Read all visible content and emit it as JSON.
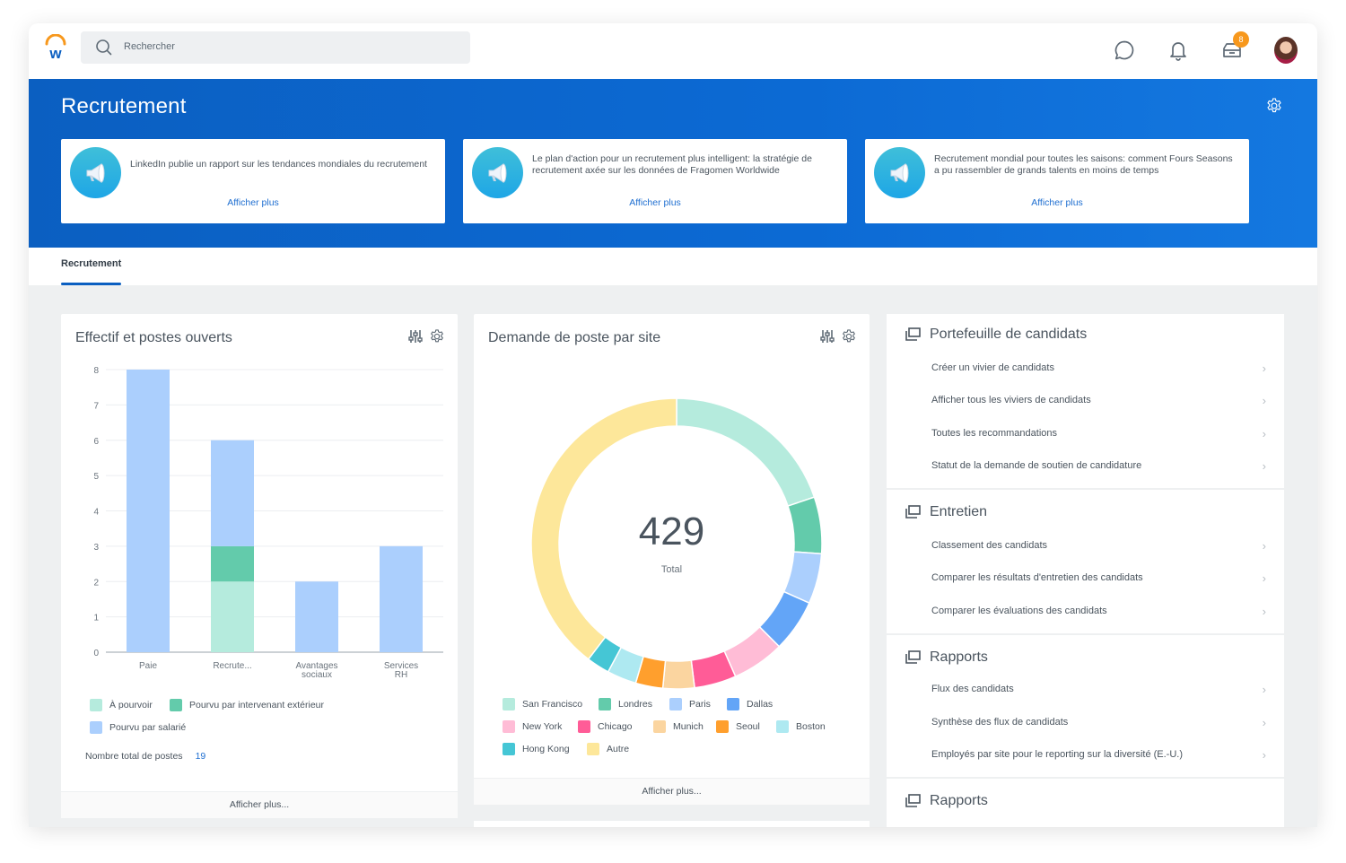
{
  "app": {
    "logo": "workday-logo"
  },
  "search": {
    "placeholder": "Rechercher"
  },
  "header_icons": {
    "chat": "chat-icon",
    "bell": "bell-icon",
    "inbox": "inbox-icon",
    "inbox_badge": "8",
    "avatar": "avatar"
  },
  "banner": {
    "title": "Recrutement",
    "news": [
      {
        "text": "LinkedIn publie un rapport sur les tendances mondiales du recrutement",
        "link": "Afficher plus"
      },
      {
        "text": "Le plan d'action pour un recrutement plus intelligent: la stratégie de recrutement axée sur les données de Fragomen Worldwide",
        "link": "Afficher plus"
      },
      {
        "text": "Recrutement mondial pour toutes les saisons: comment Fours Seasons a pu rassembler de grands talents en moins de temps",
        "link": "Afficher plus"
      }
    ]
  },
  "tabs": [
    {
      "label": "Recrutement",
      "active": true
    }
  ],
  "cards": {
    "headcount": {
      "title": "Effectif et postes ouverts",
      "total_label": "Nombre total de postes",
      "total_value": "19",
      "footer": "Afficher plus..."
    },
    "requisitions": {
      "title": "Demande de poste par site",
      "center_value": "429",
      "center_label": "Total",
      "footer": "Afficher plus..."
    }
  },
  "chart_data": [
    {
      "type": "bar",
      "stacked": true,
      "title": "Effectif et postes ouverts",
      "categories": [
        "Paie",
        "Recrute...",
        "Avantages sociaux",
        "Services RH"
      ],
      "category_lines": [
        [
          "Paie"
        ],
        [
          "Recrute..."
        ],
        [
          "Avantages",
          "sociaux"
        ],
        [
          "Services",
          "RH"
        ]
      ],
      "series": [
        {
          "name": "À pourvoir",
          "color": "#b5ebdd",
          "values": [
            0,
            2,
            0,
            0
          ]
        },
        {
          "name": "Pourvu par intervenant extérieur",
          "color": "#63cbab",
          "values": [
            0,
            1,
            0,
            0
          ]
        },
        {
          "name": "Pourvu par salarié",
          "color": "#abcffd",
          "values": [
            8,
            3,
            2,
            3
          ]
        }
      ],
      "ylim": [
        0,
        8
      ],
      "yticks": [
        "0",
        "1",
        "2",
        "3",
        "4",
        "5",
        "6",
        "7",
        "8"
      ],
      "grid": true,
      "legend": "bottom"
    },
    {
      "type": "pie",
      "donut": true,
      "title": "Demande de poste par site",
      "total": 429,
      "slices": [
        {
          "name": "San Francisco",
          "value": 85,
          "color": "#b5ebdd"
        },
        {
          "name": "Londres",
          "value": 27,
          "color": "#63cbab"
        },
        {
          "name": "Paris",
          "value": 24,
          "color": "#abcffd"
        },
        {
          "name": "Dallas",
          "value": 25,
          "color": "#63a5f7"
        },
        {
          "name": "New York",
          "value": 25,
          "color": "#ffbcd6"
        },
        {
          "name": "Chicago",
          "value": 20,
          "color": "#ff5c97"
        },
        {
          "name": "Munich",
          "value": 15,
          "color": "#fbd5a0"
        },
        {
          "name": "Seoul",
          "value": 13,
          "color": "#ff9f2d"
        },
        {
          "name": "Boston",
          "value": 14,
          "color": "#aee9f1"
        },
        {
          "name": "Hong Kong",
          "value": 11,
          "color": "#45c6d5"
        },
        {
          "name": "Autre",
          "value": 170,
          "color": "#fde79a"
        }
      ],
      "legend": "bottom"
    }
  ],
  "sections": [
    {
      "title": "Portefeuille de candidats",
      "items": [
        "Créer un vivier de candidats",
        "Afficher tous les viviers de candidats",
        "Toutes les recommandations",
        "Statut de la demande de soutien de candidature"
      ]
    },
    {
      "title": "Entretien",
      "items": [
        "Classement des candidats",
        "Comparer les résultats d'entretien des candidats",
        "Comparer les évaluations des candidats"
      ]
    },
    {
      "title": "Rapports",
      "items": [
        "Flux des candidats",
        "Synthèse des flux de candidats",
        "Employés par site pour le reporting sur la diversité (E.-U.)"
      ]
    },
    {
      "title": "Rapports",
      "items": []
    }
  ]
}
